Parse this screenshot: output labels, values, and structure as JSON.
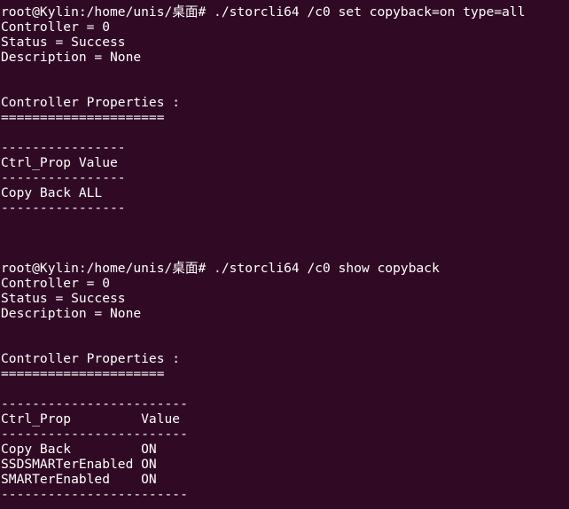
{
  "terminal": {
    "lines": [
      "root@Kylin:/home/unis/桌面# ./storcli64 /c0 set copyback=on type=all",
      "Controller = 0",
      "Status = Success",
      "Description = None",
      "",
      "",
      "Controller Properties :",
      "=====================",
      "",
      "----------------",
      "Ctrl_Prop Value",
      "----------------",
      "Copy Back ALL",
      "----------------",
      "",
      "",
      "",
      "root@Kylin:/home/unis/桌面# ./storcli64 /c0 show copyback",
      "Controller = 0",
      "Status = Success",
      "Description = None",
      "",
      "",
      "Controller Properties :",
      "=====================",
      "",
      "------------------------",
      "Ctrl_Prop         Value",
      "------------------------",
      "Copy Back         ON",
      "SSDSMARTerEnabled ON",
      "SMARTerEnabled    ON",
      "------------------------"
    ]
  }
}
